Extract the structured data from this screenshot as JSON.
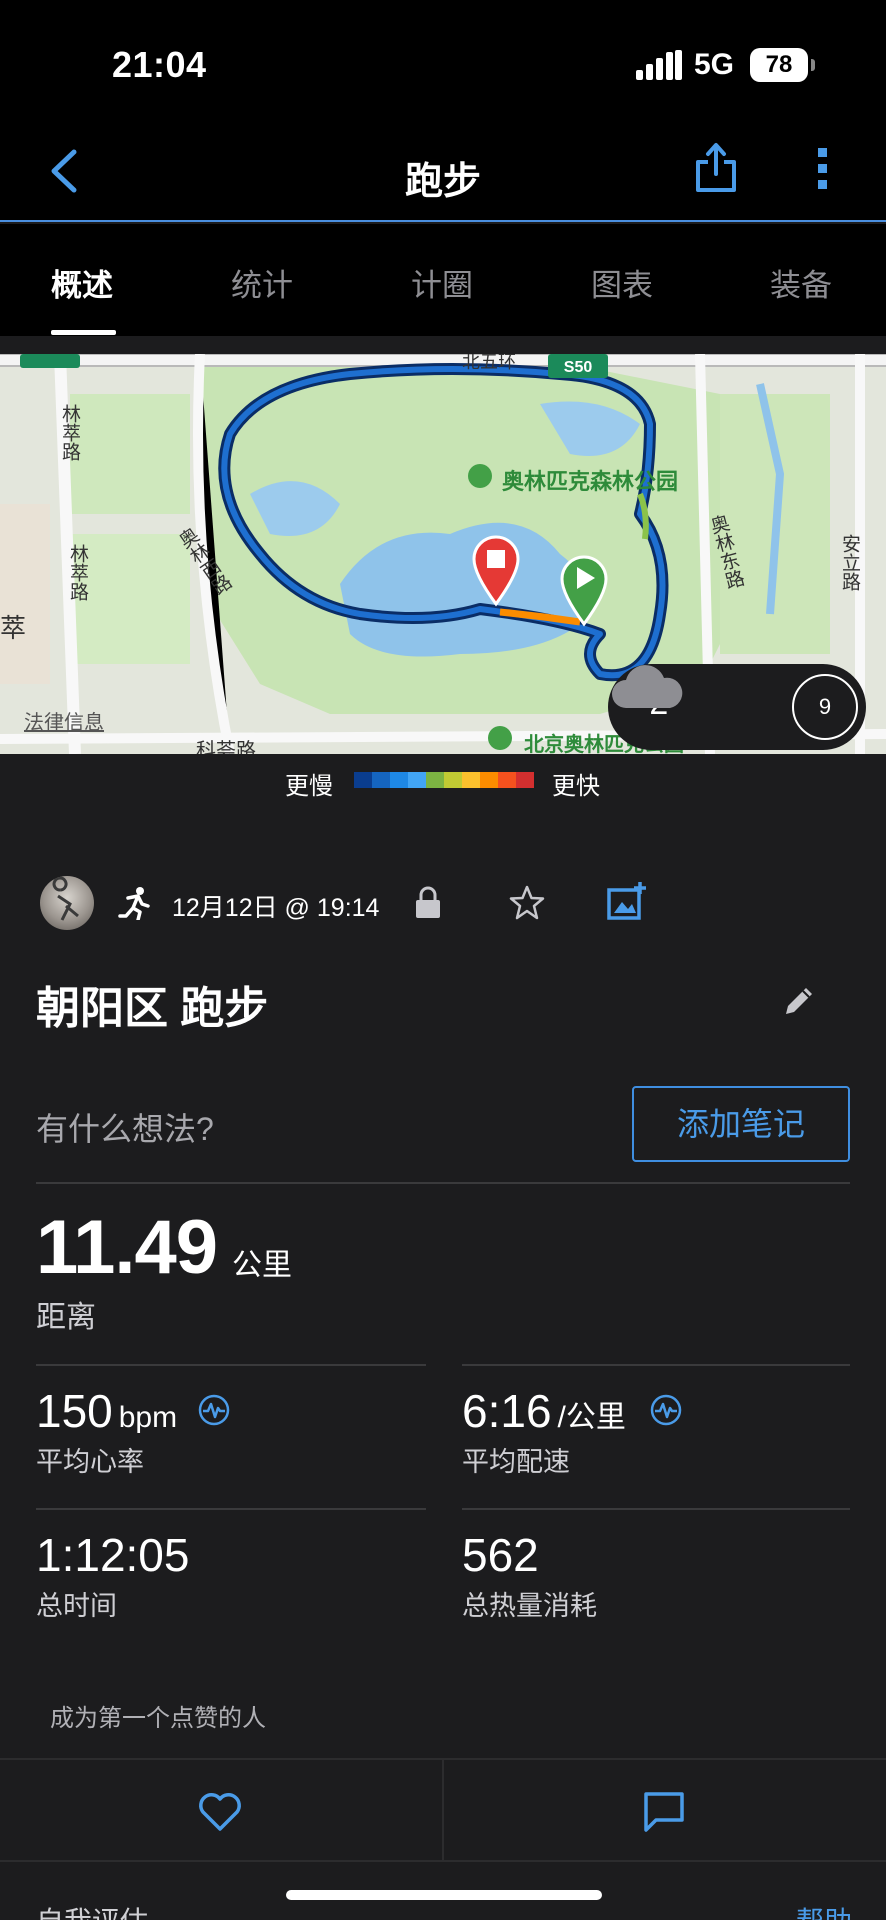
{
  "status_bar": {
    "time": "21:04",
    "network": "5G",
    "battery": "78"
  },
  "nav": {
    "title": "跑步"
  },
  "tabs": [
    {
      "label": "概述",
      "active": true
    },
    {
      "label": "统计",
      "active": false
    },
    {
      "label": "计圈",
      "active": false
    },
    {
      "label": "图表",
      "active": false
    },
    {
      "label": "装备",
      "active": false
    }
  ],
  "map": {
    "labels": {
      "park": "奥林匹克森林公园",
      "west_road": "奥林西路",
      "east_road": "奥林东路",
      "linhui_1": "林萃路",
      "linhui_2": "林萃路",
      "anli": "安立路",
      "kehui": "科荟路",
      "kehui_right": "科荟路",
      "s50": "S50",
      "north_ring": "北五环",
      "park_south": "北京奥林匹克公园",
      "cui": "萃"
    },
    "legal": "法律信息",
    "weather": {
      "temp": "-2°",
      "wind": "9"
    }
  },
  "legend": {
    "slower": "更慢",
    "faster": "更快",
    "colors": [
      "#0a3d8f",
      "#1565c0",
      "#1e88e5",
      "#42a5f5",
      "#7cb342",
      "#c0ca33",
      "#fbc02d",
      "#fb8c00",
      "#f4511e",
      "#d32f2f"
    ]
  },
  "activity": {
    "date": "12月12日 @ 19:14",
    "title": "朝阳区 跑步",
    "thoughts_placeholder": "有什么想法?",
    "add_note": "添加笔记",
    "distance": {
      "value": "11.49",
      "unit": "公里",
      "label": "距离"
    },
    "stats": [
      {
        "value": "150",
        "unit": "bpm",
        "label": "平均心率"
      },
      {
        "value": "6:16",
        "unit": "/公里",
        "label": "平均配速"
      },
      {
        "value": "1:12:05",
        "unit": "",
        "label": "总时间"
      },
      {
        "value": "562",
        "unit": "",
        "label": "总热量消耗"
      }
    ],
    "likes_text": "成为第一个点赞的人"
  },
  "bottom": {
    "left": "自我评估",
    "right": "帮助"
  }
}
